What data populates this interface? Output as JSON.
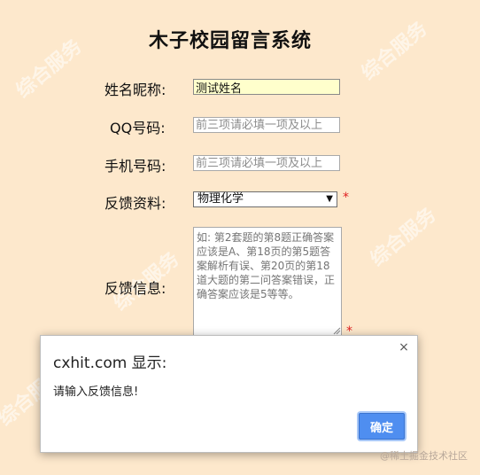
{
  "page": {
    "title": "木子校园留言系统",
    "watermark_text": "综合服务"
  },
  "form": {
    "name_label": "姓名昵称:",
    "name_value": "测试姓名",
    "qq_label": "QQ号码:",
    "qq_placeholder": "前三项请必填一项及以上",
    "phone_label": "手机号码:",
    "phone_placeholder": "前三项请必填一项及以上",
    "feedback_label": "反馈资料:",
    "feedback_selected": "物理化学",
    "info_label": "反馈信息:",
    "info_placeholder": "如: 第2套题的第8题正确答案应该是A、第18页的第5题答案解析有误、第20页的第18道大题的第二问答案错误，正确答案应该是5等等。",
    "required_mark": "*"
  },
  "dialog": {
    "title": "cxhit.com 显示:",
    "message": "请输入反馈信息!",
    "ok_label": "确定",
    "close_glyph": "×"
  },
  "footer": {
    "credit": "@稀土掘金技术社区"
  }
}
